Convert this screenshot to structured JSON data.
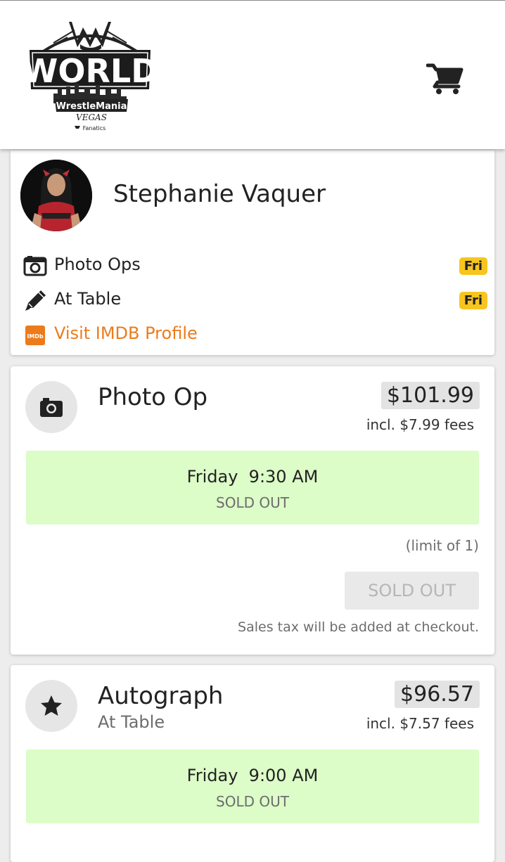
{
  "header": {
    "logo": {
      "brand": "WWE",
      "title": "WORLD",
      "subtitle": "WrestleMania",
      "location": "VEGAS",
      "sponsor": "Fanatics"
    },
    "cart_icon": "shopping-cart-icon"
  },
  "profile": {
    "name": "Stephanie Vaquer",
    "items": [
      {
        "icon": "camera-icon",
        "label": "Photo Ops",
        "badge": "Fri"
      },
      {
        "icon": "pencil-icon",
        "label": "At Table",
        "badge": "Fri"
      },
      {
        "icon": "imdb-icon",
        "label": "Visit IMDB Profile",
        "icon_text": "IMDb"
      }
    ]
  },
  "products": [
    {
      "icon": "camera-icon",
      "title": "Photo Op",
      "subtitle": "",
      "price": "$101.99",
      "fees": "incl. $7.99 fees",
      "slot": {
        "time": "Friday  9:30 AM",
        "status": "SOLD OUT"
      },
      "limit": "(limit of 1)",
      "button": "SOLD OUT",
      "tax_note": "Sales tax will be added at checkout."
    },
    {
      "icon": "star-icon",
      "title": "Autograph",
      "subtitle": "At Table",
      "price": "$96.57",
      "fees": "incl. $7.57 fees",
      "slot": {
        "time": "Friday  9:00 AM",
        "status": "SOLD OUT"
      }
    }
  ],
  "colors": {
    "accent_orange": "#ec7b1b",
    "badge_yellow": "#f7c51e",
    "slot_green": "#dcfcc8"
  }
}
